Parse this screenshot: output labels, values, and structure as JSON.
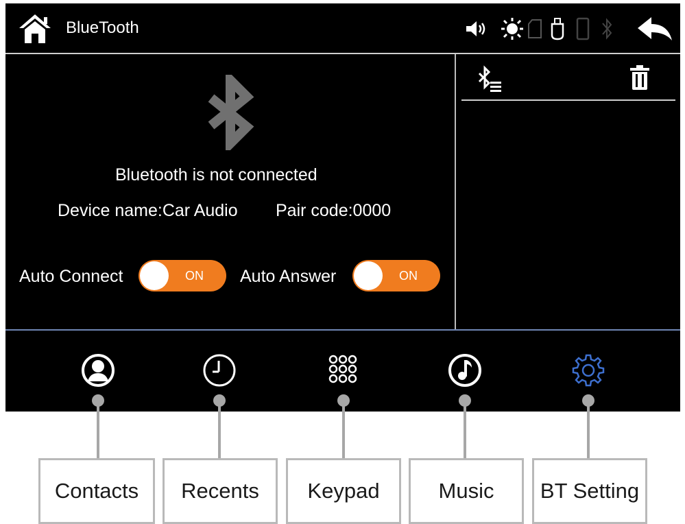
{
  "header": {
    "title": "BlueTooth"
  },
  "status": {
    "message": "Bluetooth is not connected",
    "device_name": "Device name:Car Audio",
    "pair_code": "Pair code:0000"
  },
  "toggles": {
    "auto_connect_label": "Auto Connect",
    "auto_connect_value": "ON",
    "auto_answer_label": "Auto Answer",
    "auto_answer_value": "ON"
  },
  "nav": [
    {
      "label": "Contacts",
      "icon": "contacts-icon"
    },
    {
      "label": "Recents",
      "icon": "clock-icon"
    },
    {
      "label": "Keypad",
      "icon": "keypad-icon"
    },
    {
      "label": "Music",
      "icon": "music-note-icon"
    },
    {
      "label": "BT Setting",
      "icon": "gear-icon"
    }
  ],
  "colors": {
    "background": "#000000",
    "toggle_on": "#f07c1f",
    "active_tab": "#3d6fcf",
    "divider": "#6f86b5"
  }
}
